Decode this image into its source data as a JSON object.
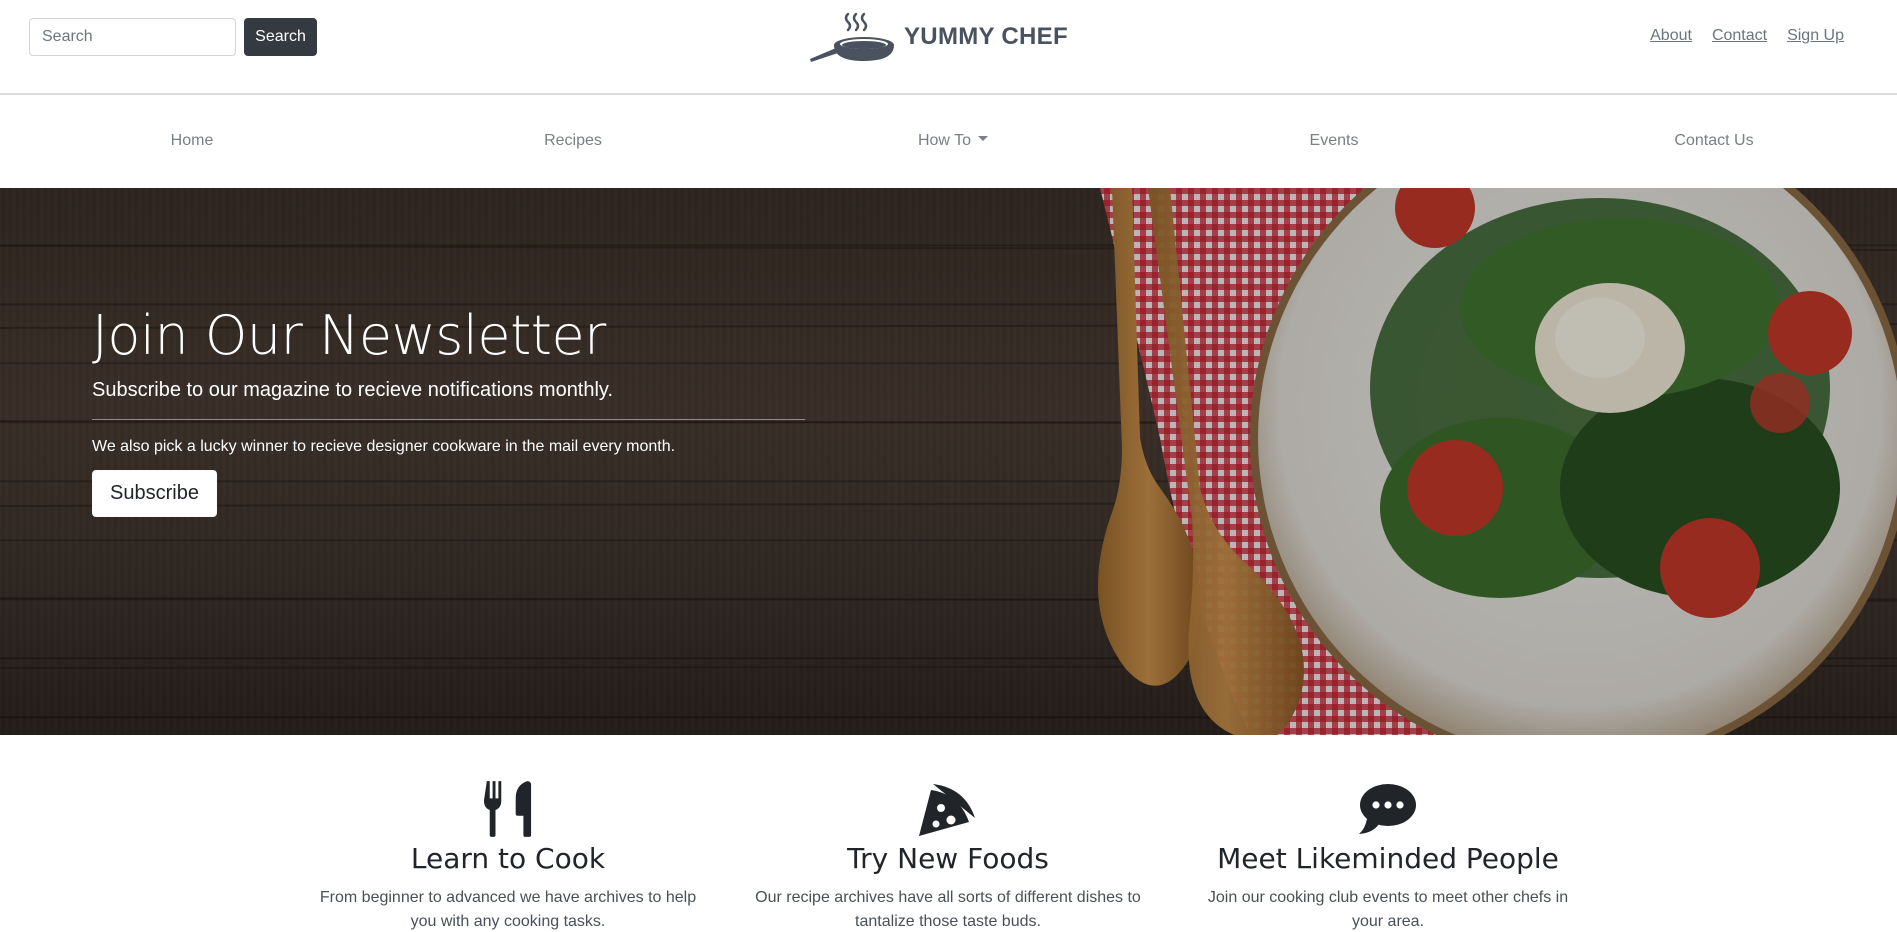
{
  "search": {
    "placeholder": "Search",
    "button_label": "Search"
  },
  "brand": {
    "name": "YUMMY CHEF",
    "logo_icon": "frying-pan-steam-icon",
    "color": "#4a5260"
  },
  "top_links": [
    {
      "label": "About"
    },
    {
      "label": "Contact"
    },
    {
      "label": "Sign Up"
    }
  ],
  "nav": {
    "items": [
      {
        "label": "Home"
      },
      {
        "label": "Recipes"
      },
      {
        "label": "How To",
        "has_dropdown": true
      },
      {
        "label": "Events"
      },
      {
        "label": "Contact Us"
      }
    ]
  },
  "hero": {
    "title": "Join Our Newsletter",
    "lead": "Subscribe to our magazine to recieve notifications monthly.",
    "text": "We also pick a lucky winner to recieve designer cookware in the mail every month.",
    "button_label": "Subscribe",
    "image": "wooden-table-spoons-salad-plate"
  },
  "features": [
    {
      "icon": "utensils-icon",
      "title": "Learn to Cook",
      "text": "From beginner to advanced we have archives to help you with any cooking tasks."
    },
    {
      "icon": "pizza-slice-icon",
      "title": "Try New Foods",
      "text": "Our recipe archives have all sorts of different dishes to tantalize those taste buds."
    },
    {
      "icon": "comment-dots-icon",
      "title": "Meet Likeminded People",
      "text": "Join our cooking club events to meet other chefs in your area."
    }
  ],
  "colors": {
    "dark_button": "#343a40",
    "link_muted": "#6c757d",
    "icon_dark": "#212529"
  }
}
